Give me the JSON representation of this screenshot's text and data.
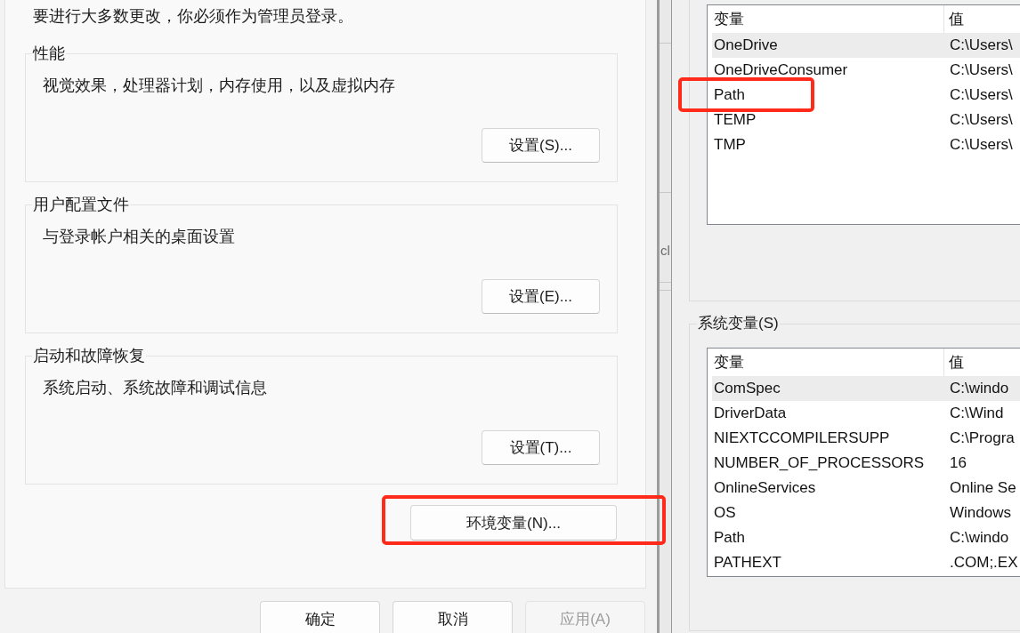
{
  "system_properties": {
    "admin_note": "要进行大多数更改，你必须作为管理员登录。",
    "groups": [
      {
        "title": "性能",
        "description": "视觉效果，处理器计划，内存使用，以及虚拟内存",
        "button": "设置(S)..."
      },
      {
        "title": "用户配置文件",
        "description": "与登录帐户相关的桌面设置",
        "button": "设置(E)..."
      },
      {
        "title": "启动和故障恢复",
        "description": "系统启动、系统故障和调试信息",
        "button": "设置(T)..."
      }
    ],
    "environment_button": {
      "label": "环境变量(N)...",
      "highlighted": true
    },
    "buttons": [
      {
        "label": "确定",
        "disabled": false
      },
      {
        "label": "取消",
        "disabled": false
      },
      {
        "label": "应用(A)",
        "disabled": true
      }
    ]
  },
  "background_window": {
    "text": "cl"
  },
  "environment_variables": {
    "user_variables": {
      "columns": [
        "变量",
        "值"
      ],
      "rows": [
        {
          "variable": "OneDrive",
          "value": "C:\\Users\\",
          "selected": true,
          "highlighted": false
        },
        {
          "variable": "OneDriveConsumer",
          "value": "C:\\Users\\",
          "selected": false,
          "highlighted": false
        },
        {
          "variable": "Path",
          "value": "C:\\Users\\",
          "selected": false,
          "highlighted": true
        },
        {
          "variable": "TEMP",
          "value": "C:\\Users\\",
          "selected": false,
          "highlighted": false
        },
        {
          "variable": "TMP",
          "value": "C:\\Users\\",
          "selected": false,
          "highlighted": false
        }
      ]
    },
    "system_variables": {
      "title": "系统变量(S)",
      "columns": [
        "变量",
        "值"
      ],
      "rows": [
        {
          "variable": "ComSpec",
          "value": "C:\\windo",
          "selected": true,
          "highlighted": false
        },
        {
          "variable": "DriverData",
          "value": "C:\\Wind",
          "selected": false,
          "highlighted": false
        },
        {
          "variable": "NIEXTCCOMPILERSUPP",
          "value": "C:\\Progra",
          "selected": false,
          "highlighted": false
        },
        {
          "variable": "NUMBER_OF_PROCESSORS",
          "value": "16",
          "selected": false,
          "highlighted": false
        },
        {
          "variable": "OnlineServices",
          "value": "Online Se",
          "selected": false,
          "highlighted": false
        },
        {
          "variable": "OS",
          "value": "Windows",
          "selected": false,
          "highlighted": false
        },
        {
          "variable": "Path",
          "value": "C:\\windo",
          "selected": false,
          "highlighted": false
        },
        {
          "variable": "PATHEXT",
          "value": ".COM;.EX",
          "selected": false,
          "highlighted": false
        }
      ]
    }
  }
}
